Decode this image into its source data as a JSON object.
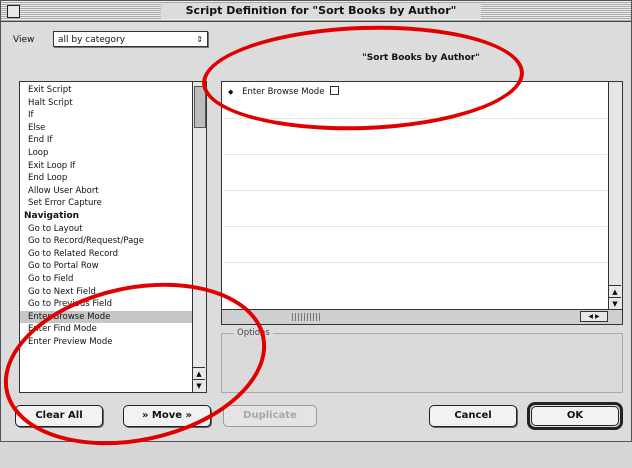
{
  "window": {
    "title": "Script Definition for \"Sort Books by Author\""
  },
  "view": {
    "label": "View",
    "selected": "all by category"
  },
  "steps": [
    {
      "label": "Exit Script",
      "type": "item"
    },
    {
      "label": "Halt Script",
      "type": "item"
    },
    {
      "label": "If",
      "type": "item"
    },
    {
      "label": "Else",
      "type": "item"
    },
    {
      "label": "End If",
      "type": "item"
    },
    {
      "label": "Loop",
      "type": "item"
    },
    {
      "label": "Exit Loop If",
      "type": "item"
    },
    {
      "label": "End Loop",
      "type": "item"
    },
    {
      "label": "Allow User Abort",
      "type": "item"
    },
    {
      "label": "Set Error Capture",
      "type": "item"
    },
    {
      "label": "Navigation",
      "type": "heading"
    },
    {
      "label": "Go to Layout",
      "type": "item"
    },
    {
      "label": "Go to Record/Request/Page",
      "type": "item"
    },
    {
      "label": "Go to Related Record",
      "type": "item"
    },
    {
      "label": "Go to Portal Row",
      "type": "item"
    },
    {
      "label": "Go to Field",
      "type": "item"
    },
    {
      "label": "Go to Next Field",
      "type": "item"
    },
    {
      "label": "Go to Previous Field",
      "type": "item"
    },
    {
      "label": "Enter Browse Mode",
      "type": "item",
      "selected": true
    },
    {
      "label": "Enter Find Mode",
      "type": "item"
    },
    {
      "label": "Enter Preview Mode",
      "type": "item"
    }
  ],
  "script": {
    "name": "\"Sort Books by Author\"",
    "lines": [
      "Enter Browse Mode"
    ]
  },
  "options": {
    "label": "Options"
  },
  "buttons": {
    "clear_all": "Clear All",
    "move": "» Move »",
    "duplicate": "Duplicate",
    "cancel": "Cancel",
    "ok": "OK"
  },
  "icons": {
    "close_box": "close-box-icon",
    "popup_arrow": "popup-arrows-icon",
    "scroll_up": "scroll-up-arrow-icon",
    "scroll_down": "scroll-down-arrow-icon"
  },
  "colors": {
    "annotation": "#e00000",
    "selection": "#c6c6c6"
  }
}
